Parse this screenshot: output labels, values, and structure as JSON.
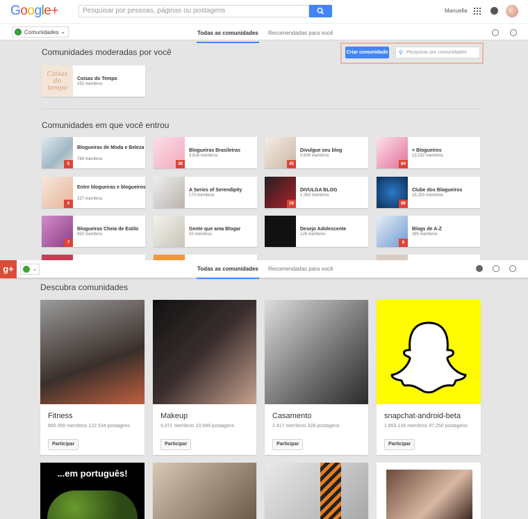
{
  "header": {
    "logo_text": "Google+",
    "search_placeholder": "Pesquisar por pessoas, páginas ou postagens",
    "user_name": "Manuella"
  },
  "subnav": {
    "selector_label": "Comunidades",
    "tabs": [
      {
        "label": "Todas as comunidades",
        "active": true
      },
      {
        "label": "Recomendadas para você",
        "active": false
      }
    ]
  },
  "moderated": {
    "title": "Comunidades moderadas por você",
    "create_button": "Criar comunidade",
    "search_placeholder": "Pesquisar por comunidades",
    "items": [
      {
        "name": "Coisas do Tempo",
        "members": "152 membros"
      }
    ]
  },
  "joined": {
    "title": "Comunidades em que você entrou",
    "items": [
      {
        "name": "Blogueiras de Moda e Beleza",
        "members": "789 membros",
        "badge": "5"
      },
      {
        "name": "Blogueiras Brasileiras",
        "members": "3.816 membros",
        "badge": "38"
      },
      {
        "name": "Divulgue seu blog",
        "members": "3.608 membros",
        "badge": "45"
      },
      {
        "name": "+ Blogueiros",
        "members": "13.232 membros",
        "badge": "84"
      },
      {
        "name": "Entre blogueiras e blogueiros",
        "members": "227 membros",
        "badge": "6"
      },
      {
        "name": "A Series of Serendipity",
        "members": "170 membros",
        "badge": ""
      },
      {
        "name": "DIVULGA BLOG",
        "members": "1.263 membros",
        "badge": "19"
      },
      {
        "name": "Clube dos Blogueiros",
        "members": "15.253 membros",
        "badge": "89"
      },
      {
        "name": "Blogueiras Cheia de Estilo",
        "members": "952 membros",
        "badge": "7"
      },
      {
        "name": "Gente que ama Blogar",
        "members": "92 membros",
        "badge": ""
      },
      {
        "name": "Desejo Adolescente",
        "members": "126 membros",
        "badge": ""
      },
      {
        "name": "Blogs de A-Z",
        "members": "385 membros",
        "badge": "6"
      }
    ]
  },
  "fixed_bar": {
    "logo": "g+",
    "tabs": [
      {
        "label": "Todas as comunidades",
        "active": true
      },
      {
        "label": "Recomendadas para você",
        "active": false
      }
    ]
  },
  "discover": {
    "title": "Descubra comunidades",
    "join_label": "Participar",
    "items": [
      {
        "name": "Fitness",
        "stats": "800.056 membros   122.534 postagens"
      },
      {
        "name": "Makeup",
        "stats": "9.071 membros   10.589 postagens"
      },
      {
        "name": "Casamento",
        "stats": "2.417 membros   328 postagens"
      },
      {
        "name": "snapchat-android-beta",
        "stats": "1.853.134 membros   97.250 postagens"
      }
    ],
    "second_row_caption": "...em português!"
  },
  "colors": {
    "accent": "#4285f4",
    "badge": "#db4437",
    "gplus": "#dd4b39",
    "highlight_border": "#e9b5a3",
    "snapchat_yellow": "#fffc00"
  }
}
